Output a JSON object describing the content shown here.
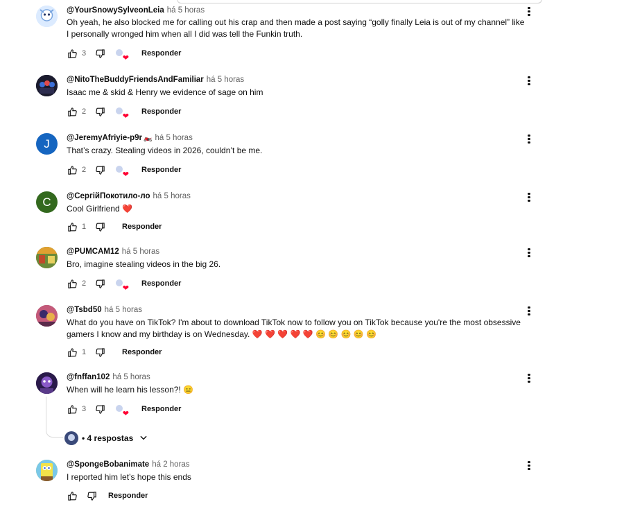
{
  "comments": [
    {
      "author": "@YourSnowySylveonLeia",
      "time": "há 5 horas",
      "text": "Oh yeah, he also blocked me for calling out his crap and then made a post saying “golly finally Leia is out of my channel” like I personally wronged him when all I did was tell the Funkin truth.",
      "likes": "3",
      "reply_label": "Responder",
      "avatar_color": "#cfe3ff"
    },
    {
      "author": "@NitoTheBuddyFriendsAndFamiliar",
      "time": "há 5 horas",
      "text": "Isaac me & skid & Henry we evidence of sage on him",
      "likes": "2",
      "reply_label": "Responder",
      "avatar_color": "#1b1b2e"
    },
    {
      "author": "@JeremyAfriyie-p9r",
      "badge": "🏍️",
      "time": "há 5 horas",
      "text": "That’s crazy. Stealing videos in 2026, couldn’t be me.",
      "likes": "2",
      "reply_label": "Responder",
      "avatar_letter": "J",
      "avatar_color": "#1565c0"
    },
    {
      "author": "@СергійПокотило-ло",
      "time": "há 5 horas",
      "text": "Cool Girlfriend",
      "text_emoji": "❤️",
      "likes": "1",
      "reply_label": "Responder",
      "avatar_letter": "C",
      "avatar_color": "#33691e"
    },
    {
      "author": "@PUMCAM12",
      "time": "há 5 horas",
      "text": "Bro, imagine stealing videos in the big 26.",
      "likes": "2",
      "reply_label": "Responder",
      "avatar_color": "#c7a03a"
    },
    {
      "author": "@Tsbd50",
      "time": "há 5 horas",
      "text": "What do you have on TikTok? I'm about to download TikTok now to follow you on TikTok because you're the most obsessive gamers I know and my birthday is on Wednesday.",
      "text_emoji": "❤️ ❤️ ❤️ ❤️ ❤️ 😊 😊 😊 😊 😊",
      "likes": "1",
      "reply_label": "Responder",
      "avatar_color": "#8a3b5a"
    },
    {
      "author": "@fnffan102",
      "time": "há 5 horas",
      "text": "When will he learn his lesson?!",
      "text_emoji": "😑",
      "likes": "3",
      "reply_label": "Responder",
      "avatar_color": "#4a2a6a"
    },
    {
      "author": "@SpongeBobanimate",
      "time": "há 2 horas",
      "text": "I reported him let’s hope this ends",
      "likes": "",
      "reply_label": "Responder",
      "avatar_color": "#e6d84a"
    }
  ],
  "replies_toggle": {
    "label": "• 4 respostas"
  },
  "icons": {
    "like": "thumbs-up-icon",
    "dislike": "thumbs-down-icon",
    "menu": "more-vert-icon",
    "creator_heart": "creator-heart-icon",
    "expand": "chevron-down-icon"
  }
}
